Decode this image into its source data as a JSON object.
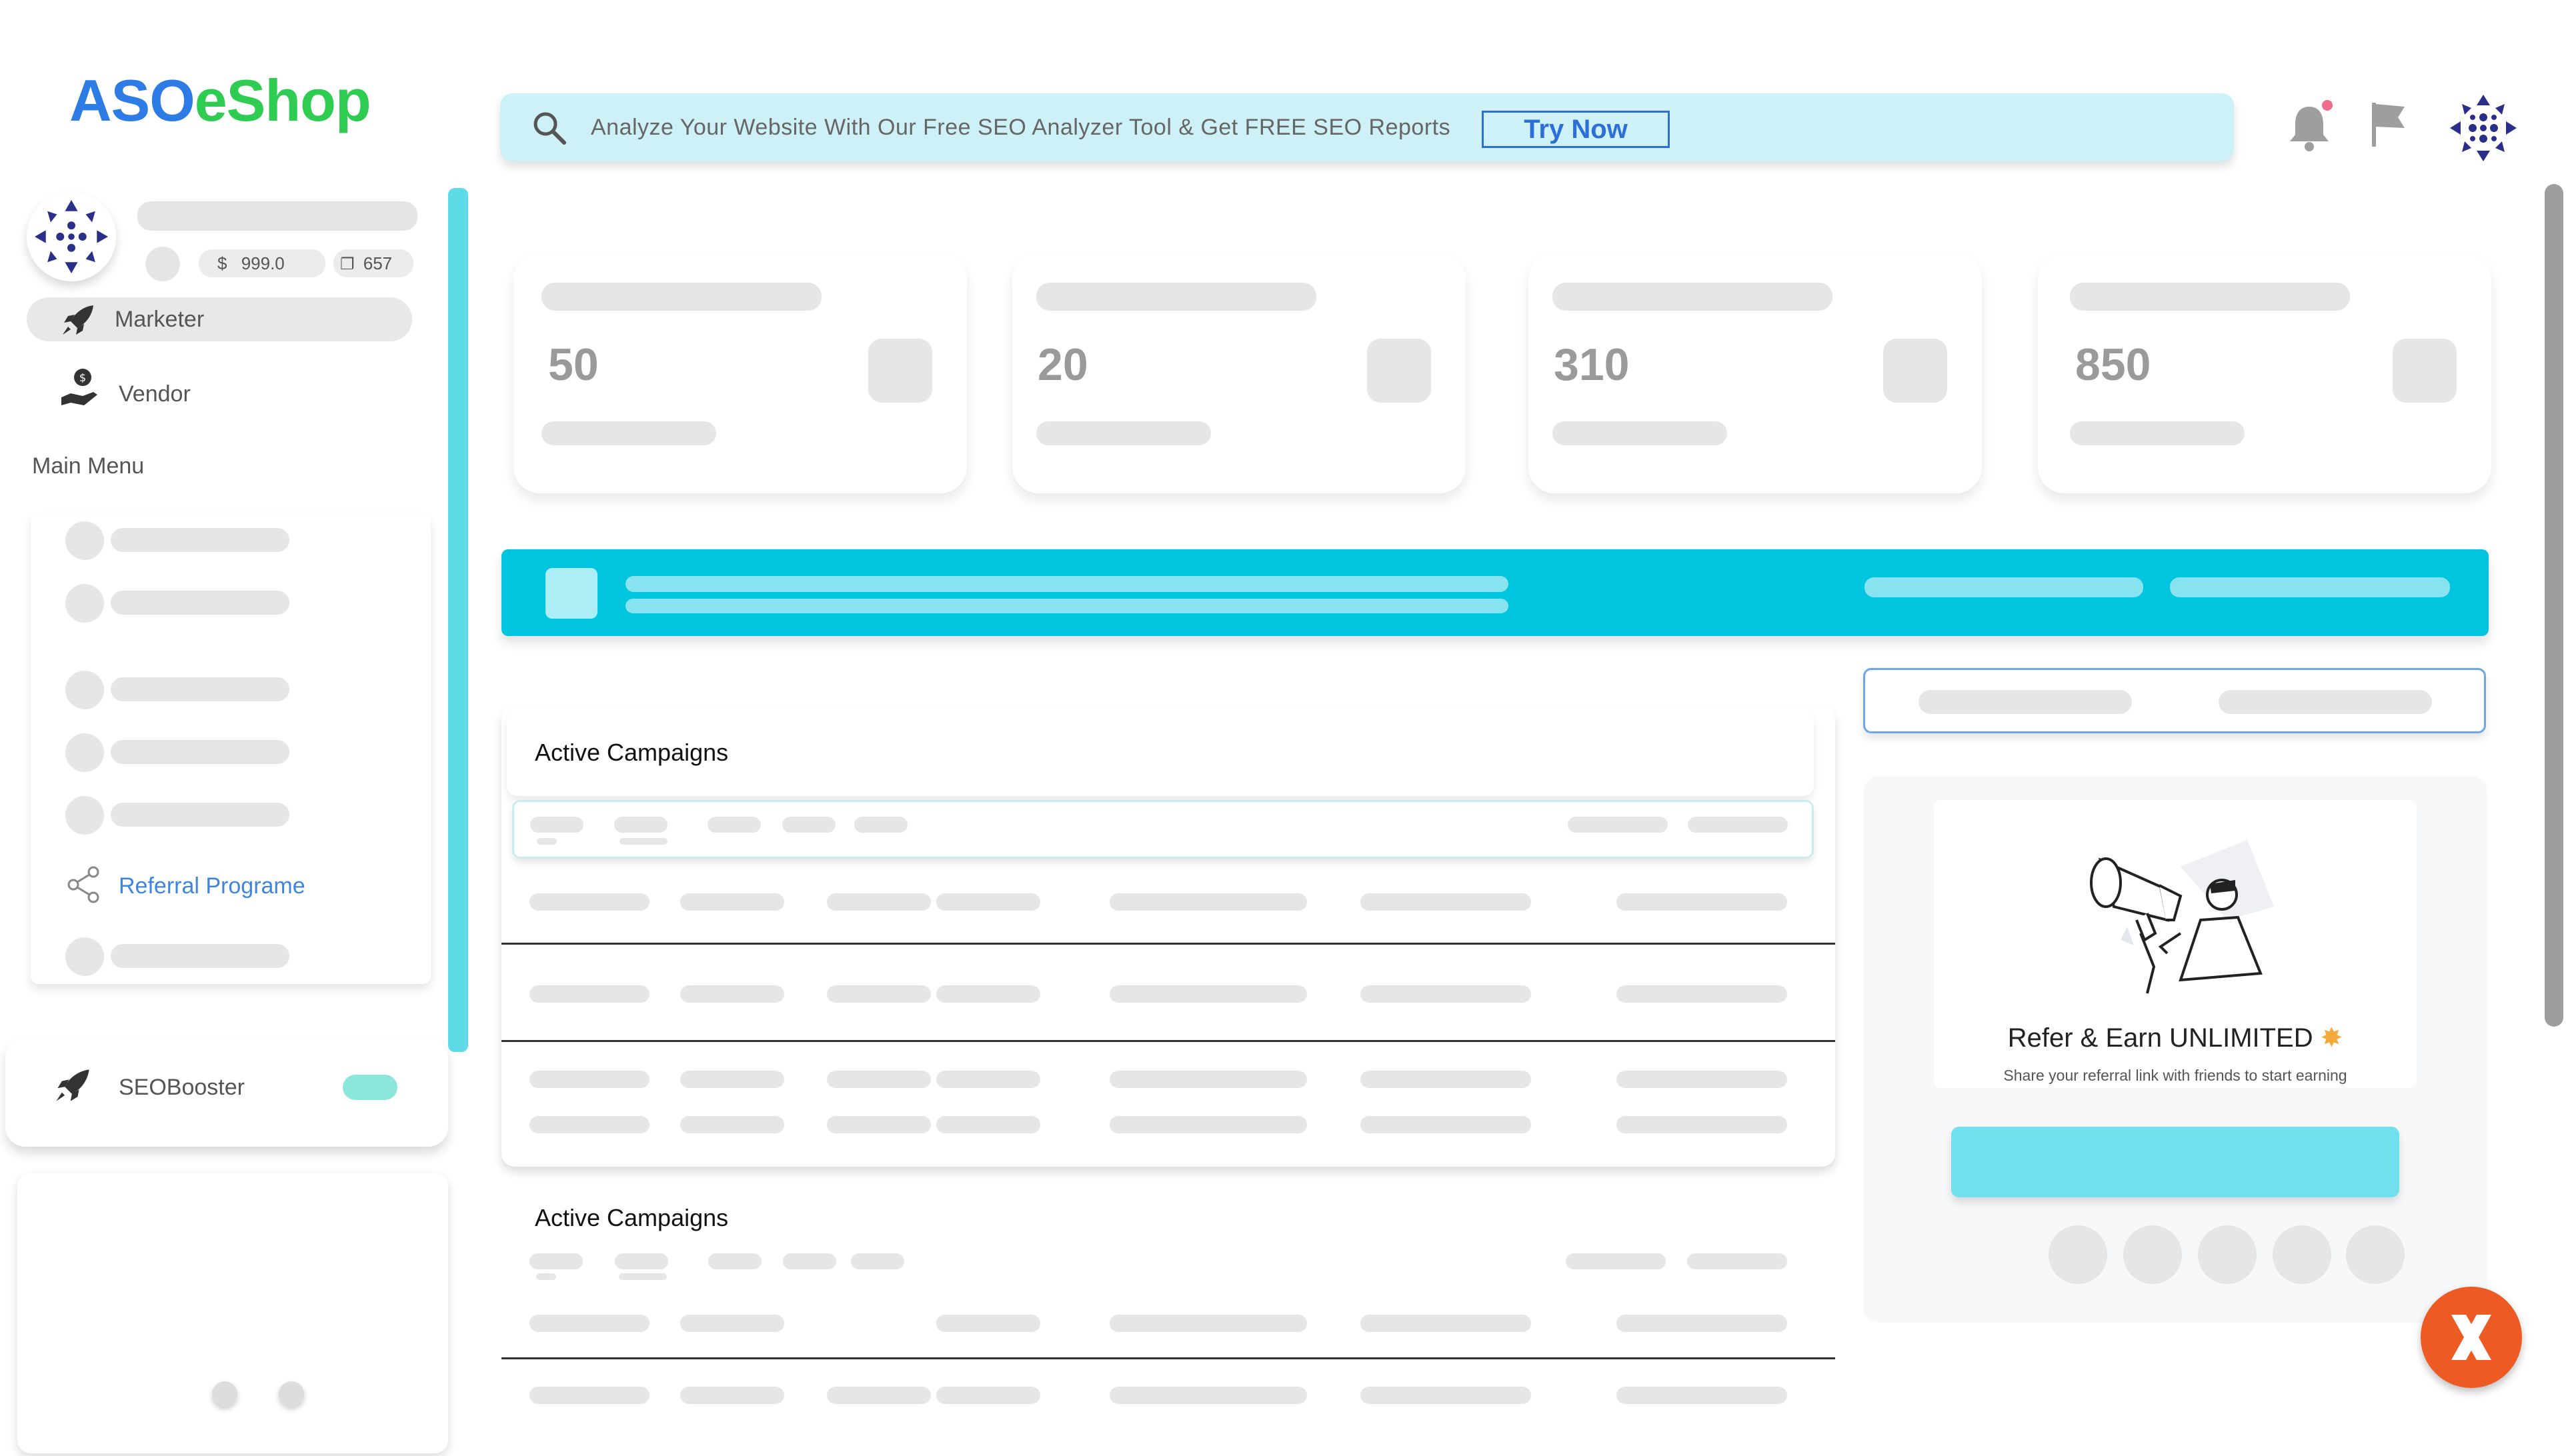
{
  "app": {
    "logo_part1": "ASO",
    "logo_part2": "eShop"
  },
  "banner": {
    "text": "Analyze Your Website With Our Free SEO Analyzer Tool & Get FREE SEO Reports",
    "button_label": "Try Now"
  },
  "header": {
    "icons": [
      "bell-icon",
      "flag-icon",
      "avatar"
    ]
  },
  "profile": {
    "balance": "999.0",
    "credits": "657"
  },
  "sidebar": {
    "roles": [
      {
        "label": "Marketer",
        "icon": "rocket-icon"
      },
      {
        "label": "Vendor",
        "icon": "hand-coin-icon"
      }
    ],
    "section_label": "Main Menu",
    "referral_label": "Referral Programe",
    "seo_label": "SEOBooster"
  },
  "stats": [
    {
      "value": "50"
    },
    {
      "value": "20"
    },
    {
      "value": "310"
    },
    {
      "value": "850"
    }
  ],
  "tables": {
    "title_1": "Active Campaigns",
    "title_2": "Active Campaigns"
  },
  "referral_card": {
    "title": "Refer & Earn UNLIMITED",
    "subtitle": "Share your referral link with friends to start earning"
  },
  "colors": {
    "accent": "#01c5de",
    "logo_blue": "#2d7be5",
    "logo_green": "#2ecc51",
    "fab": "#ee5a24"
  }
}
